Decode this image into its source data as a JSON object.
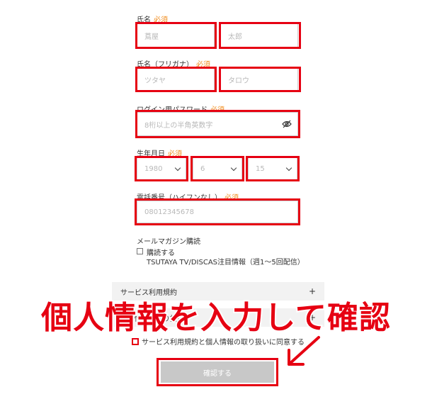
{
  "colors": {
    "required": "#f08c1e",
    "highlight": "#e60012",
    "button_bg": "#c8c8c8"
  },
  "form": {
    "required_label": "必須",
    "name": {
      "label": "氏名",
      "last_placeholder": "蔦屋",
      "first_placeholder": "太郎"
    },
    "kana": {
      "label": "氏名（フリガナ）",
      "last_placeholder": "ツタヤ",
      "first_placeholder": "タロウ"
    },
    "password": {
      "label": "ログイン用パスワード",
      "placeholder": "8桁以上の半角英数字",
      "icon": "eye-slash-icon"
    },
    "birthday": {
      "label": "生年月日",
      "year": "1980",
      "month": "6",
      "day": "15"
    },
    "phone": {
      "label": "電話番号（ハイフンなし）",
      "placeholder": "08012345678"
    },
    "newsletter": {
      "label": "メールマガジン購読",
      "option_label": "購読する",
      "option_desc": "TSUTAYA TV/DISCAS注目情報（週1～5回配信）"
    },
    "accordions": [
      {
        "label": "サービス利用規約"
      },
      {
        "label": "個人情報の取り扱い"
      }
    ],
    "agree_label": "サービス利用規約と個人情報の取り扱いに同意する",
    "confirm_label": "確認する"
  },
  "annotation": {
    "text": "個人情報を入力して確認"
  }
}
